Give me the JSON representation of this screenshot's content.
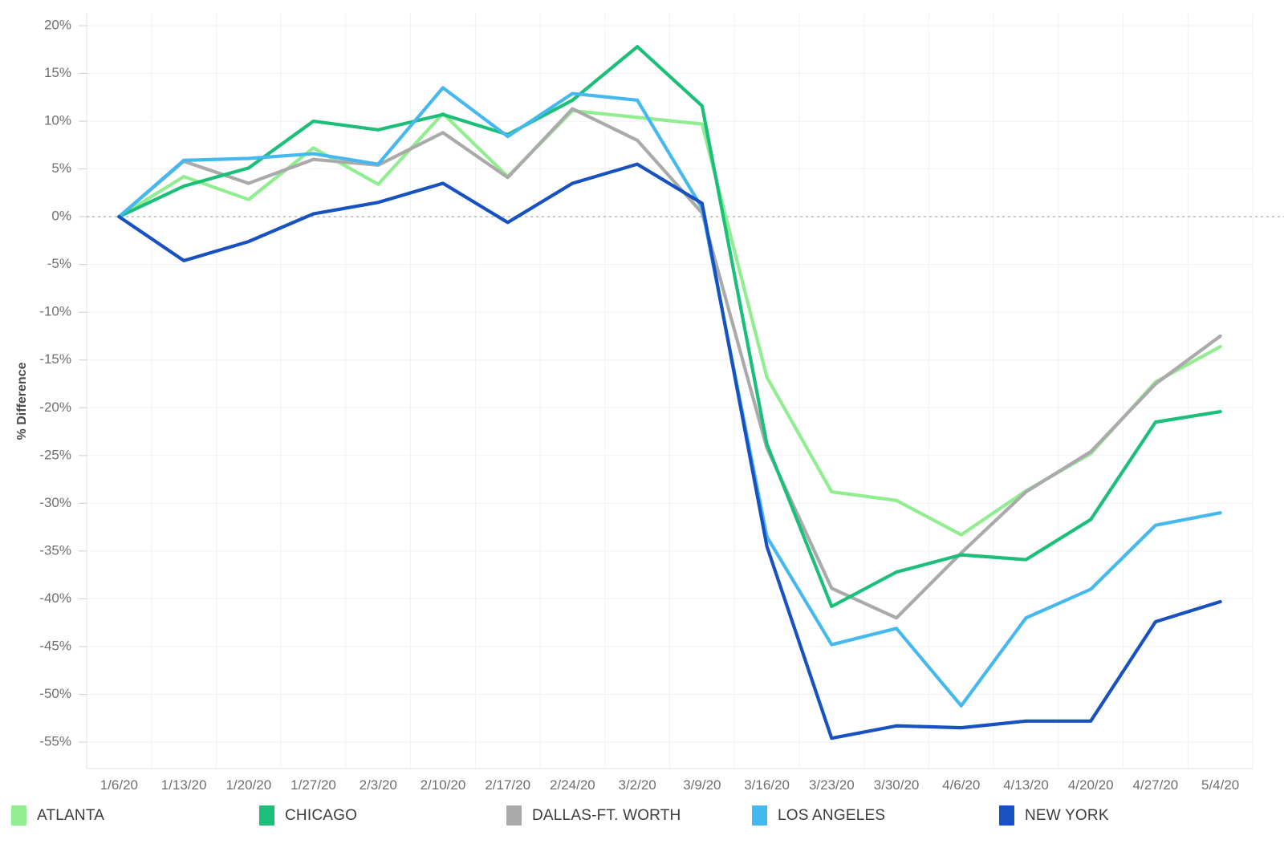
{
  "chart_data": {
    "type": "line",
    "title": "",
    "xlabel": "",
    "ylabel": "% Difference",
    "ylim": [
      -55,
      20
    ],
    "ytick_step": 5,
    "grid": true,
    "legend_position": "bottom",
    "categories": [
      "1/6/20",
      "1/13/20",
      "1/20/20",
      "1/27/20",
      "2/3/20",
      "2/10/20",
      "2/17/20",
      "2/24/20",
      "3/2/20",
      "3/9/20",
      "3/16/20",
      "3/23/20",
      "3/30/20",
      "4/6/20",
      "4/13/20",
      "4/20/20",
      "4/27/20",
      "5/4/20"
    ],
    "ytick_labels": [
      "20%",
      "15%",
      "10%",
      "5%",
      "0%",
      "-5%",
      "-10%",
      "-15%",
      "-20%",
      "-25%",
      "-30%",
      "-35%",
      "-40%",
      "-45%",
      "-50%",
      "-55%"
    ],
    "ytick_values": [
      20,
      15,
      10,
      5,
      0,
      -5,
      -10,
      -15,
      -20,
      -25,
      -30,
      -35,
      -40,
      -45,
      -50,
      -55
    ],
    "series": [
      {
        "name": "ATLANTA",
        "color": "#90EE90",
        "values": [
          0,
          4.2,
          1.8,
          7.2,
          3.4,
          10.8,
          4.2,
          11.1,
          10.4,
          9.7,
          -16.8,
          -28.8,
          -29.7,
          -33.3,
          -28.7,
          -24.8,
          -17.3,
          -13.6
        ]
      },
      {
        "name": "CHICAGO",
        "color": "#1BBF7A",
        "values": [
          0,
          3.2,
          5.1,
          10.0,
          9.1,
          10.7,
          8.6,
          12.2,
          17.8,
          11.6,
          -23.8,
          -40.8,
          -37.2,
          -35.4,
          -35.9,
          -31.7,
          -21.5,
          -20.4
        ]
      },
      {
        "name": "DALLAS-FT. WORTH",
        "color": "#AAAAAA",
        "values": [
          0,
          5.8,
          3.5,
          6.0,
          5.4,
          8.8,
          4.1,
          11.3,
          8.0,
          0.4,
          -24.2,
          -38.9,
          -42.0,
          -35.2,
          -28.8,
          -24.6,
          -17.5,
          -12.5
        ]
      },
      {
        "name": "LOS ANGELES",
        "color": "#46B8F0",
        "values": [
          0,
          5.9,
          6.1,
          6.6,
          5.5,
          13.5,
          8.4,
          12.9,
          12.2,
          0.9,
          -33.5,
          -44.8,
          -43.1,
          -51.2,
          -42.0,
          -39.0,
          -32.3,
          -31.0
        ]
      },
      {
        "name": "NEW YORK",
        "color": "#1752C0",
        "values": [
          0,
          -4.6,
          -2.6,
          0.3,
          1.5,
          3.5,
          -0.6,
          3.5,
          5.5,
          1.4,
          -34.5,
          -54.6,
          -53.3,
          -53.5,
          -52.8,
          -52.8,
          -42.4,
          -40.3
        ]
      }
    ]
  },
  "legend": {
    "items": [
      {
        "label": "ATLANTA",
        "color": "#90EE90"
      },
      {
        "label": "CHICAGO",
        "color": "#1BBF7A"
      },
      {
        "label": "DALLAS-FT. WORTH",
        "color": "#AAAAAA"
      },
      {
        "label": "LOS ANGELES",
        "color": "#46B8F0"
      },
      {
        "label": "NEW YORK",
        "color": "#1752C0"
      }
    ]
  }
}
